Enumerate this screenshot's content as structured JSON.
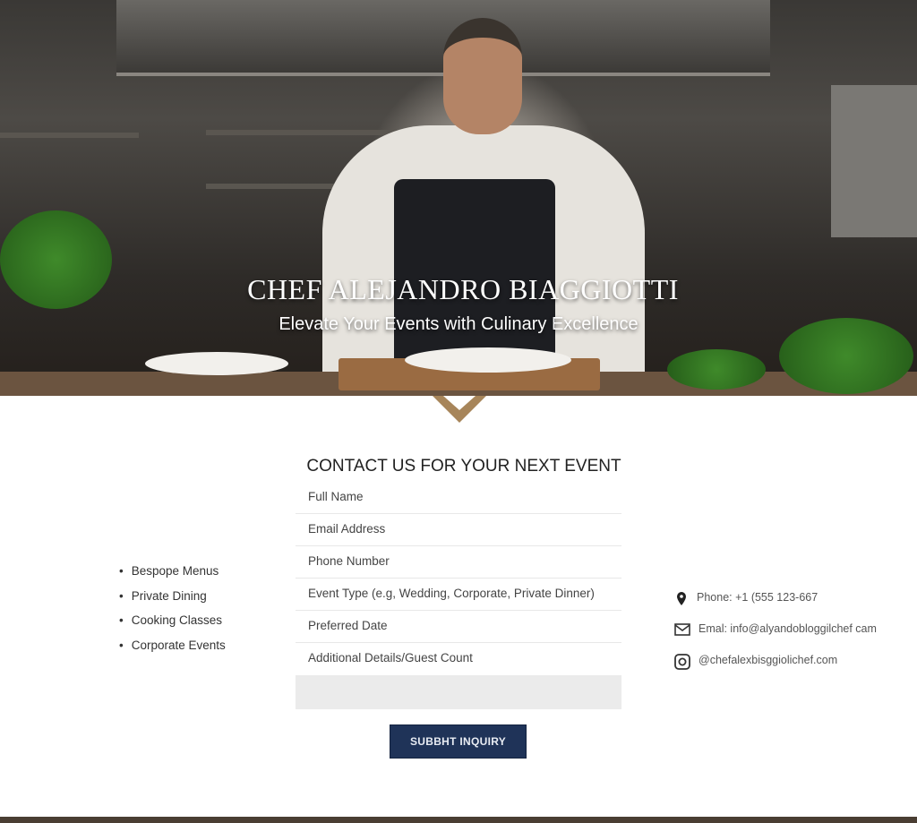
{
  "hero": {
    "title": "CHEF ALEJANDRO BIAGGIOTTI",
    "subtitle": "Elevate Your Events with Culinary Excellence"
  },
  "services": [
    "Bespope Menus",
    "Private Dining",
    "Cooking Classes",
    "Corporate Events"
  ],
  "form": {
    "heading": "CONTACT US FOR YOUR NEXT EVENT",
    "fields": [
      "Full Name",
      "Email Address",
      "Phone Number",
      "Event Type (e.g, Wedding, Corporate, Private Dinner)",
      "Preferred Date",
      "Additional Details/Guest Count"
    ],
    "submit_label": "SUBBHT INQUIRY"
  },
  "contact": {
    "phone": "Phone: +1 (555 123-667",
    "email": "Emal: info@alyandobloggilchef cam",
    "instagram": "@chefalexbisggiolichef.com"
  },
  "colors": {
    "accent": "#a7855a",
    "button": "#1f3358"
  },
  "icons": {
    "phone": "map-pin-icon",
    "email": "envelope-icon",
    "instagram": "instagram-icon"
  }
}
